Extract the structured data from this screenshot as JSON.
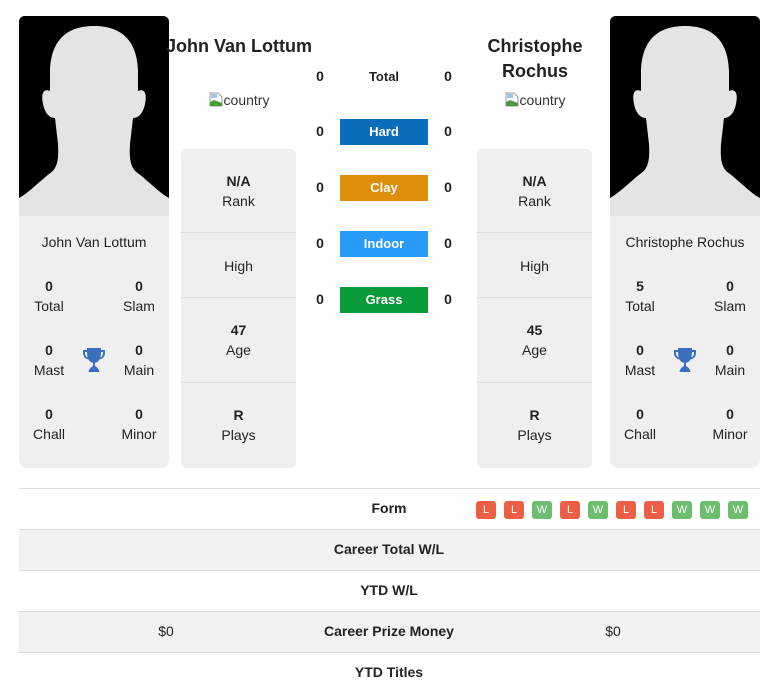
{
  "player1": {
    "name": "John Van Lottum",
    "card_name": "John Van Lottum",
    "flag_alt": "country",
    "rank": {
      "value": "N/A",
      "label": "Rank"
    },
    "high": {
      "label": "High"
    },
    "age": {
      "value": "47",
      "label": "Age"
    },
    "plays": {
      "value": "R",
      "label": "Plays"
    },
    "titles": {
      "total": {
        "value": "0",
        "label": "Total"
      },
      "slam": {
        "value": "0",
        "label": "Slam"
      },
      "mast": {
        "value": "0",
        "label": "Mast"
      },
      "main": {
        "value": "0",
        "label": "Main"
      },
      "chall": {
        "value": "0",
        "label": "Chall"
      },
      "minor": {
        "value": "0",
        "label": "Minor"
      }
    }
  },
  "player2": {
    "name": "Christophe Rochus",
    "card_name": "Christophe Rochus",
    "flag_alt": "country",
    "rank": {
      "value": "N/A",
      "label": "Rank"
    },
    "high": {
      "label": "High"
    },
    "age": {
      "value": "45",
      "label": "Age"
    },
    "plays": {
      "value": "R",
      "label": "Plays"
    },
    "titles": {
      "total": {
        "value": "5",
        "label": "Total"
      },
      "slam": {
        "value": "0",
        "label": "Slam"
      },
      "mast": {
        "value": "0",
        "label": "Mast"
      },
      "main": {
        "value": "0",
        "label": "Main"
      },
      "chall": {
        "value": "0",
        "label": "Chall"
      },
      "minor": {
        "value": "0",
        "label": "Minor"
      }
    }
  },
  "h2h": [
    {
      "label": "Total",
      "p1": "0",
      "p2": "0",
      "color": ""
    },
    {
      "label": "Hard",
      "p1": "0",
      "p2": "0",
      "color": "#0a6ebd"
    },
    {
      "label": "Clay",
      "p1": "0",
      "p2": "0",
      "color": "#dd8e0b"
    },
    {
      "label": "Indoor",
      "p1": "0",
      "p2": "0",
      "color": "#2a9bf5"
    },
    {
      "label": "Grass",
      "p1": "0",
      "p2": "0",
      "color": "#0a9a3a"
    }
  ],
  "table": {
    "form_label": "Form",
    "form": [
      "L",
      "L",
      "W",
      "L",
      "W",
      "L",
      "L",
      "W",
      "W",
      "W"
    ],
    "form_colors": {
      "W": "#6cbd6e",
      "L": "#ed5f45"
    },
    "rows": [
      {
        "label": "Career Total W/L",
        "p1": "",
        "p2": ""
      },
      {
        "label": "YTD W/L",
        "p1": "",
        "p2": ""
      },
      {
        "label": "Career Prize Money",
        "p1": "$0",
        "p2": "$0"
      },
      {
        "label": "YTD Titles",
        "p1": "",
        "p2": ""
      }
    ]
  },
  "icons": {
    "trophy": "trophy-icon",
    "avatar": "avatar-silhouette",
    "flag": "broken-image-icon"
  },
  "colors": {
    "trophy": "#3a6fbf",
    "card_bg": "#efefef"
  }
}
